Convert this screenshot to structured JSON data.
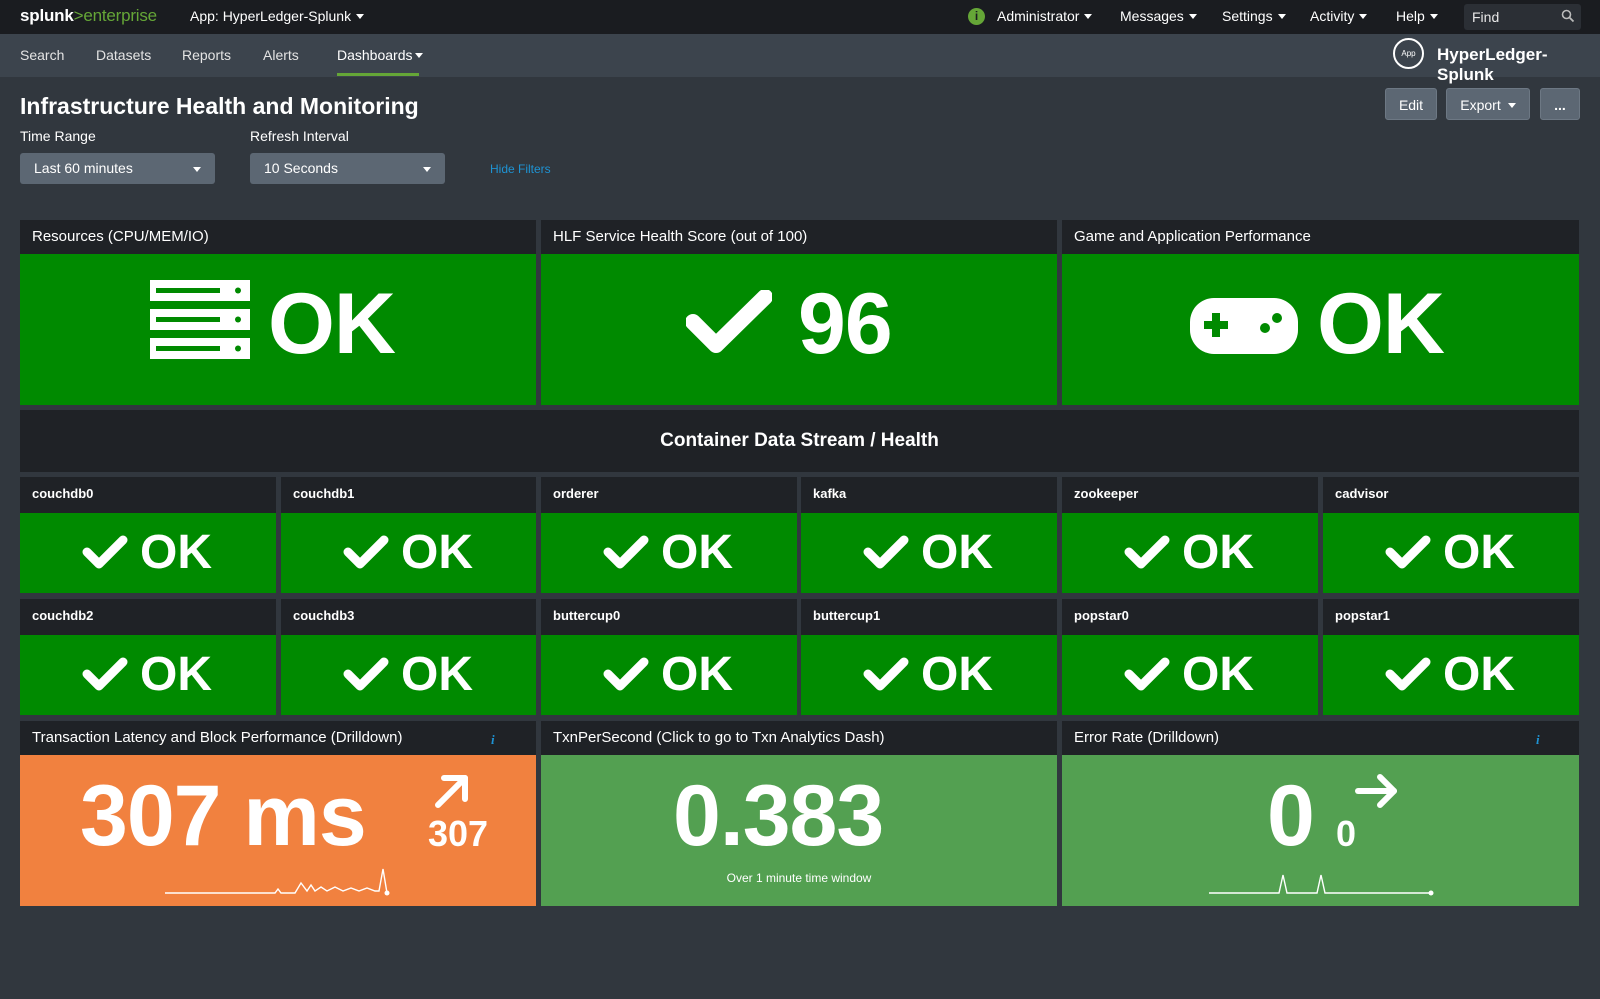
{
  "topbar": {
    "logo": {
      "part1": "splunk",
      "part2": ">",
      "part3": "enterprise"
    },
    "app_label": "App: HyperLedger-Splunk",
    "status_icon": "info-circle-icon",
    "menus": [
      "Administrator",
      "Messages",
      "Settings",
      "Activity",
      "Help"
    ],
    "find_placeholder": "Find"
  },
  "navbar": {
    "items": [
      "Search",
      "Datasets",
      "Reports",
      "Alerts",
      "Dashboards"
    ],
    "active": "Dashboards",
    "app_badge": "App",
    "app_name": "HyperLedger-Splunk"
  },
  "dashboard": {
    "title": "Infrastructure Health and Monitoring",
    "buttons": {
      "edit": "Edit",
      "export": "Export",
      "more": "..."
    },
    "filters": {
      "time_range": {
        "label": "Time Range",
        "value": "Last 60 minutes"
      },
      "refresh": {
        "label": "Refresh Interval",
        "value": "10 Seconds"
      },
      "hide_link": "Hide Filters"
    }
  },
  "top_panels": [
    {
      "title": "Resources (CPU/MEM/IO)",
      "value": "OK",
      "icon": "server-icon",
      "color": "#008a00"
    },
    {
      "title": "HLF Service Health Score (out of 100)",
      "value": "96",
      "icon": "check-icon",
      "color": "#008a00"
    },
    {
      "title": "Game and Application Performance",
      "value": "OK",
      "icon": "gamepad-icon",
      "color": "#008a00"
    }
  ],
  "section_title": "Container Data Stream / Health",
  "containers": [
    {
      "name": "couchdb0",
      "status": "OK"
    },
    {
      "name": "couchdb1",
      "status": "OK"
    },
    {
      "name": "orderer",
      "status": "OK"
    },
    {
      "name": "kafka",
      "status": "OK"
    },
    {
      "name": "zookeeper",
      "status": "OK"
    },
    {
      "name": "cadvisor",
      "status": "OK"
    },
    {
      "name": "couchdb2",
      "status": "OK"
    },
    {
      "name": "couchdb3",
      "status": "OK"
    },
    {
      "name": "buttercup0",
      "status": "OK"
    },
    {
      "name": "buttercup1",
      "status": "OK"
    },
    {
      "name": "popstar0",
      "status": "OK"
    },
    {
      "name": "popstar1",
      "status": "OK"
    }
  ],
  "bottom_panels": [
    {
      "title": "Transaction Latency and Block Performance (Drilldown)",
      "value": "307 ms",
      "trend_value": "307",
      "trend_icon": "arrow-up-right-icon",
      "color": "#f1813f",
      "info_icon": "info-icon"
    },
    {
      "title": "TxnPerSecond (Click to go to Txn Analytics Dash)",
      "value": "0.383",
      "subtitle": "Over 1 minute time window",
      "color": "#53a051"
    },
    {
      "title": "Error Rate (Drilldown)",
      "value": "0",
      "trend_value": "0",
      "trend_icon": "arrow-right-icon",
      "color": "#53a051",
      "info_icon": "info-icon"
    }
  ],
  "colors": {
    "ok_green": "#008a00",
    "warning_orange": "#f1813f",
    "light_green": "#53a051",
    "accent_link": "#1e93d3",
    "splunk_green": "#65a637"
  }
}
